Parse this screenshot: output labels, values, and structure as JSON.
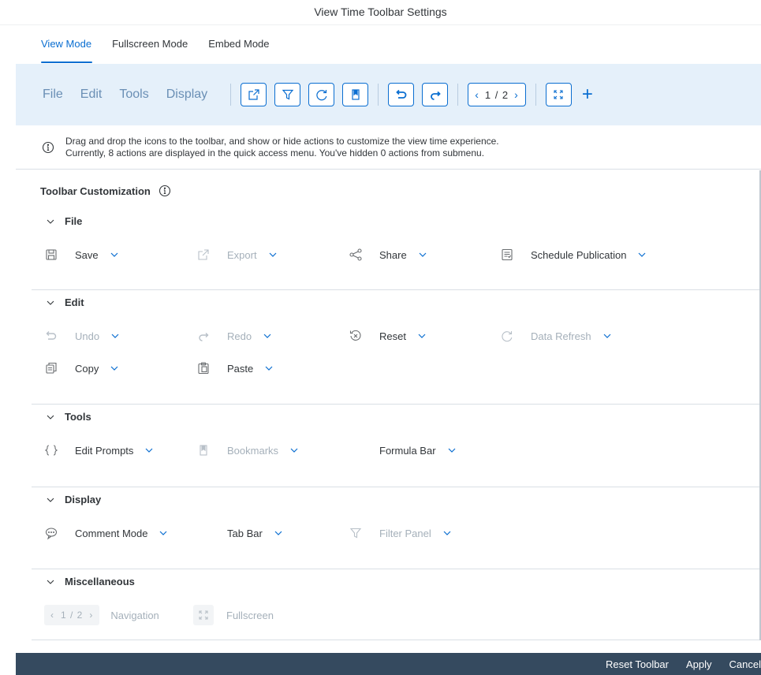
{
  "dialog": {
    "title": "View Time Toolbar Settings"
  },
  "tabs": [
    {
      "label": "View Mode",
      "active": true
    },
    {
      "label": "Fullscreen Mode",
      "active": false
    },
    {
      "label": "Embed Mode",
      "active": false
    }
  ],
  "preview": {
    "menus": [
      "File",
      "Edit",
      "Tools",
      "Display"
    ],
    "pager": "1 / 2",
    "icons": [
      "export-icon",
      "filter-icon",
      "refresh-icon",
      "bookmark-icon",
      "undo-icon",
      "redo-icon",
      "pager",
      "fullscreen-icon",
      "plus-icon"
    ]
  },
  "info": {
    "line1": "Drag and drop the icons to the toolbar, and show or hide actions to customize the view time experience.",
    "line2": "Currently, 8 actions are displayed in the quick access menu. You've hidden 0 actions from submenu."
  },
  "customization": {
    "title": "Toolbar Customization",
    "groups": [
      {
        "name": "File",
        "items": [
          {
            "label": "Save",
            "icon": "save-icon",
            "disabled": false
          },
          {
            "label": "Export",
            "icon": "export-icon",
            "disabled": true
          },
          {
            "label": "Share",
            "icon": "share-icon",
            "disabled": false
          },
          {
            "label": "Schedule Publication",
            "icon": "schedule-icon",
            "disabled": false
          }
        ]
      },
      {
        "name": "Edit",
        "items": [
          {
            "label": "Undo",
            "icon": "undo-icon",
            "disabled": true
          },
          {
            "label": "Redo",
            "icon": "redo-icon",
            "disabled": true
          },
          {
            "label": "Reset",
            "icon": "reset-icon",
            "disabled": false
          },
          {
            "label": "Data Refresh",
            "icon": "refresh-icon",
            "disabled": true
          },
          {
            "label": "Copy",
            "icon": "copy-icon",
            "disabled": false
          },
          {
            "label": "Paste",
            "icon": "paste-icon",
            "disabled": false
          }
        ]
      },
      {
        "name": "Tools",
        "items": [
          {
            "label": "Edit Prompts",
            "icon": "braces-icon",
            "disabled": false
          },
          {
            "label": "Bookmarks",
            "icon": "bookmark-icon",
            "disabled": true
          },
          {
            "label": "Formula Bar",
            "icon": "",
            "disabled": false
          }
        ]
      },
      {
        "name": "Display",
        "items": [
          {
            "label": "Comment Mode",
            "icon": "comment-icon",
            "disabled": false
          },
          {
            "label": "Tab Bar",
            "icon": "",
            "disabled": false
          },
          {
            "label": "Filter Panel",
            "icon": "filter-icon",
            "disabled": true
          }
        ]
      },
      {
        "name": "Miscellaneous",
        "items": [
          {
            "label": "Navigation",
            "icon": "pager",
            "disabled": true,
            "pager": "1 / 2"
          },
          {
            "label": "Fullscreen",
            "icon": "fullscreen-icon",
            "disabled": true
          }
        ]
      }
    ]
  },
  "footer": {
    "reset_label": "Reset Toolbar",
    "apply_label": "Apply",
    "cancel_label": "Cancel"
  },
  "colors": {
    "accent": "#0a6ed1",
    "preview_bg": "#e5f0fa",
    "footer_bg": "#354a5f",
    "disabled": "#a5b0ba"
  }
}
